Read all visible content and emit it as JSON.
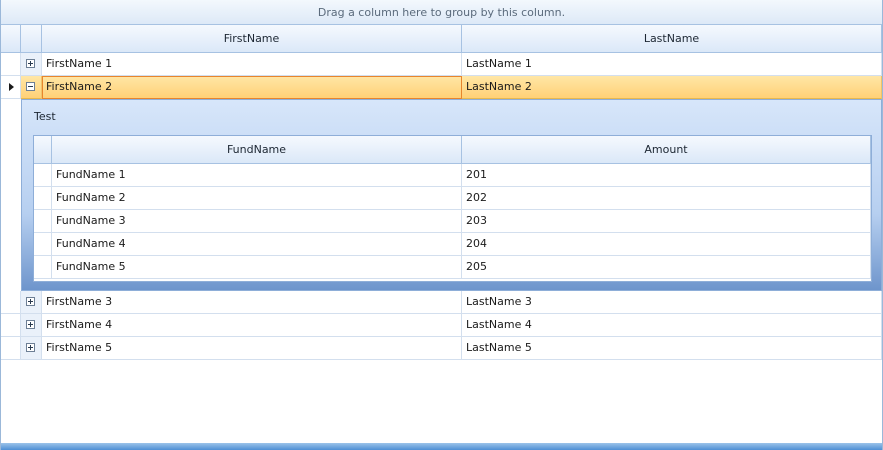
{
  "group_panel": {
    "text": "Drag a column here to group by this column."
  },
  "columns": [
    "FirstName",
    "LastName"
  ],
  "rows_top": [
    {
      "first": "FirstName 1",
      "last": "LastName 1"
    },
    {
      "first": "FirstName 2",
      "last": "LastName 2"
    }
  ],
  "detail": {
    "caption": "Test",
    "columns": [
      "FundName",
      "Amount"
    ],
    "rows": [
      {
        "fund": "FundName 1",
        "amount": "201"
      },
      {
        "fund": "FundName 2",
        "amount": "202"
      },
      {
        "fund": "FundName 3",
        "amount": "203"
      },
      {
        "fund": "FundName 4",
        "amount": "204"
      },
      {
        "fund": "FundName 5",
        "amount": "205"
      }
    ]
  },
  "rows_bottom": [
    {
      "first": "FirstName 3",
      "last": "LastName 3"
    },
    {
      "first": "FirstName 4",
      "last": "LastName 4"
    },
    {
      "first": "FirstName 5",
      "last": "LastName 5"
    }
  ],
  "colors": {
    "selection": "#ffd177",
    "selection_border": "#e8852c",
    "header": "#dbe8f8",
    "grid_border": "#9bb8d9"
  },
  "icons": {
    "expand": "plus-expander-icon",
    "collapse": "minus-expander-icon",
    "current_row": "current-row-arrow-icon"
  }
}
